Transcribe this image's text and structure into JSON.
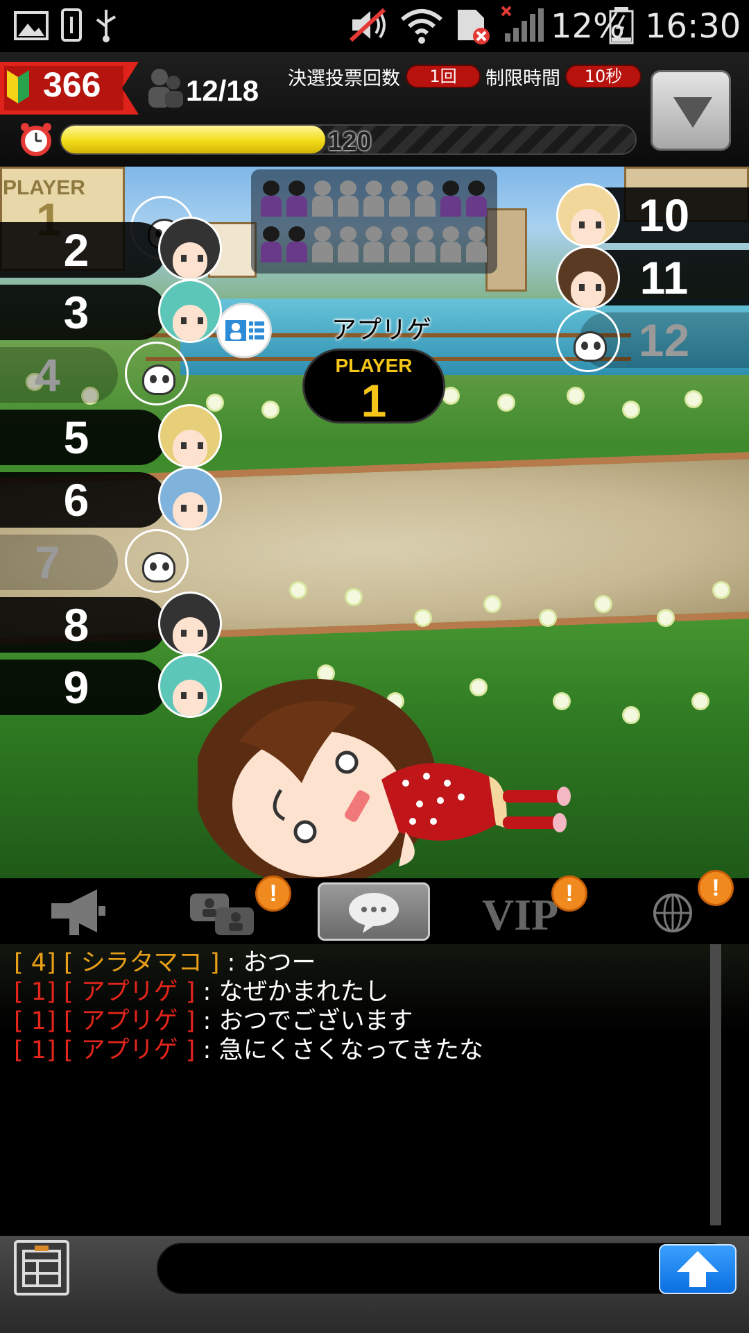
{
  "status_bar": {
    "battery_percent": "12%",
    "time": "16:30"
  },
  "header": {
    "score": "366",
    "players": "12/18",
    "final_vote_label": "決選投票回数",
    "final_vote_value": "1回",
    "time_limit_label": "制限時間",
    "time_limit_value": "10秒",
    "timer_value": "120",
    "timer_fraction": 0.46
  },
  "stage": {
    "player1_label": "PLAYER",
    "player1_num": "1",
    "left_players": [
      {
        "num": "2",
        "dim": false
      },
      {
        "num": "3",
        "dim": false
      },
      {
        "num": "4",
        "dim": true
      },
      {
        "num": "5",
        "dim": false
      },
      {
        "num": "6",
        "dim": false
      },
      {
        "num": "7",
        "dim": true
      },
      {
        "num": "8",
        "dim": false
      },
      {
        "num": "9",
        "dim": false
      }
    ],
    "right_players": [
      {
        "num": "10",
        "dim": false
      },
      {
        "num": "11",
        "dim": false
      },
      {
        "num": "12",
        "dim": true
      }
    ],
    "center_name": "アプリゲ",
    "center_badge_label": "PLAYER",
    "center_badge_num": "1"
  },
  "tabs": {
    "vip_label": "VIP",
    "notif_mark": "!"
  },
  "chat": [
    {
      "num": "[ 4]",
      "name": "[ シラタマコ ]",
      "sep": ":",
      "msg": "おつー",
      "color": "yellow"
    },
    {
      "num": "[ 1]",
      "name": "[ アプリゲ ]",
      "sep": ":",
      "msg": "なぜかまれたし",
      "color": "red"
    },
    {
      "num": "[ 1]",
      "name": "[ アプリゲ ]",
      "sep": ":",
      "msg": "おつでございます",
      "color": "red"
    },
    {
      "num": "[ 1]",
      "name": "[ アプリゲ ]",
      "sep": ":",
      "msg": "急にくさくなってきたな",
      "color": "red"
    }
  ],
  "input": {
    "placeholder": ""
  },
  "icons": {
    "statusbar": [
      "gallery-icon",
      "usb-storage-icon",
      "usb-icon",
      "mute-icon",
      "wifi-icon",
      "sim-error-icon",
      "signal-icon",
      "battery-icon"
    ],
    "tabs": [
      "megaphone-icon",
      "group-chat-icon",
      "chat-bubble-icon",
      "vip-icon",
      "globe-icon"
    ]
  },
  "colors": {
    "accent_red": "#e0231a",
    "timer_yellow": "#f2dc18",
    "chat_name_yellow": "#e8a019",
    "chat_name_red": "#e3251b",
    "send_blue": "#0a6fe0",
    "notif_orange": "#f18a1e"
  }
}
